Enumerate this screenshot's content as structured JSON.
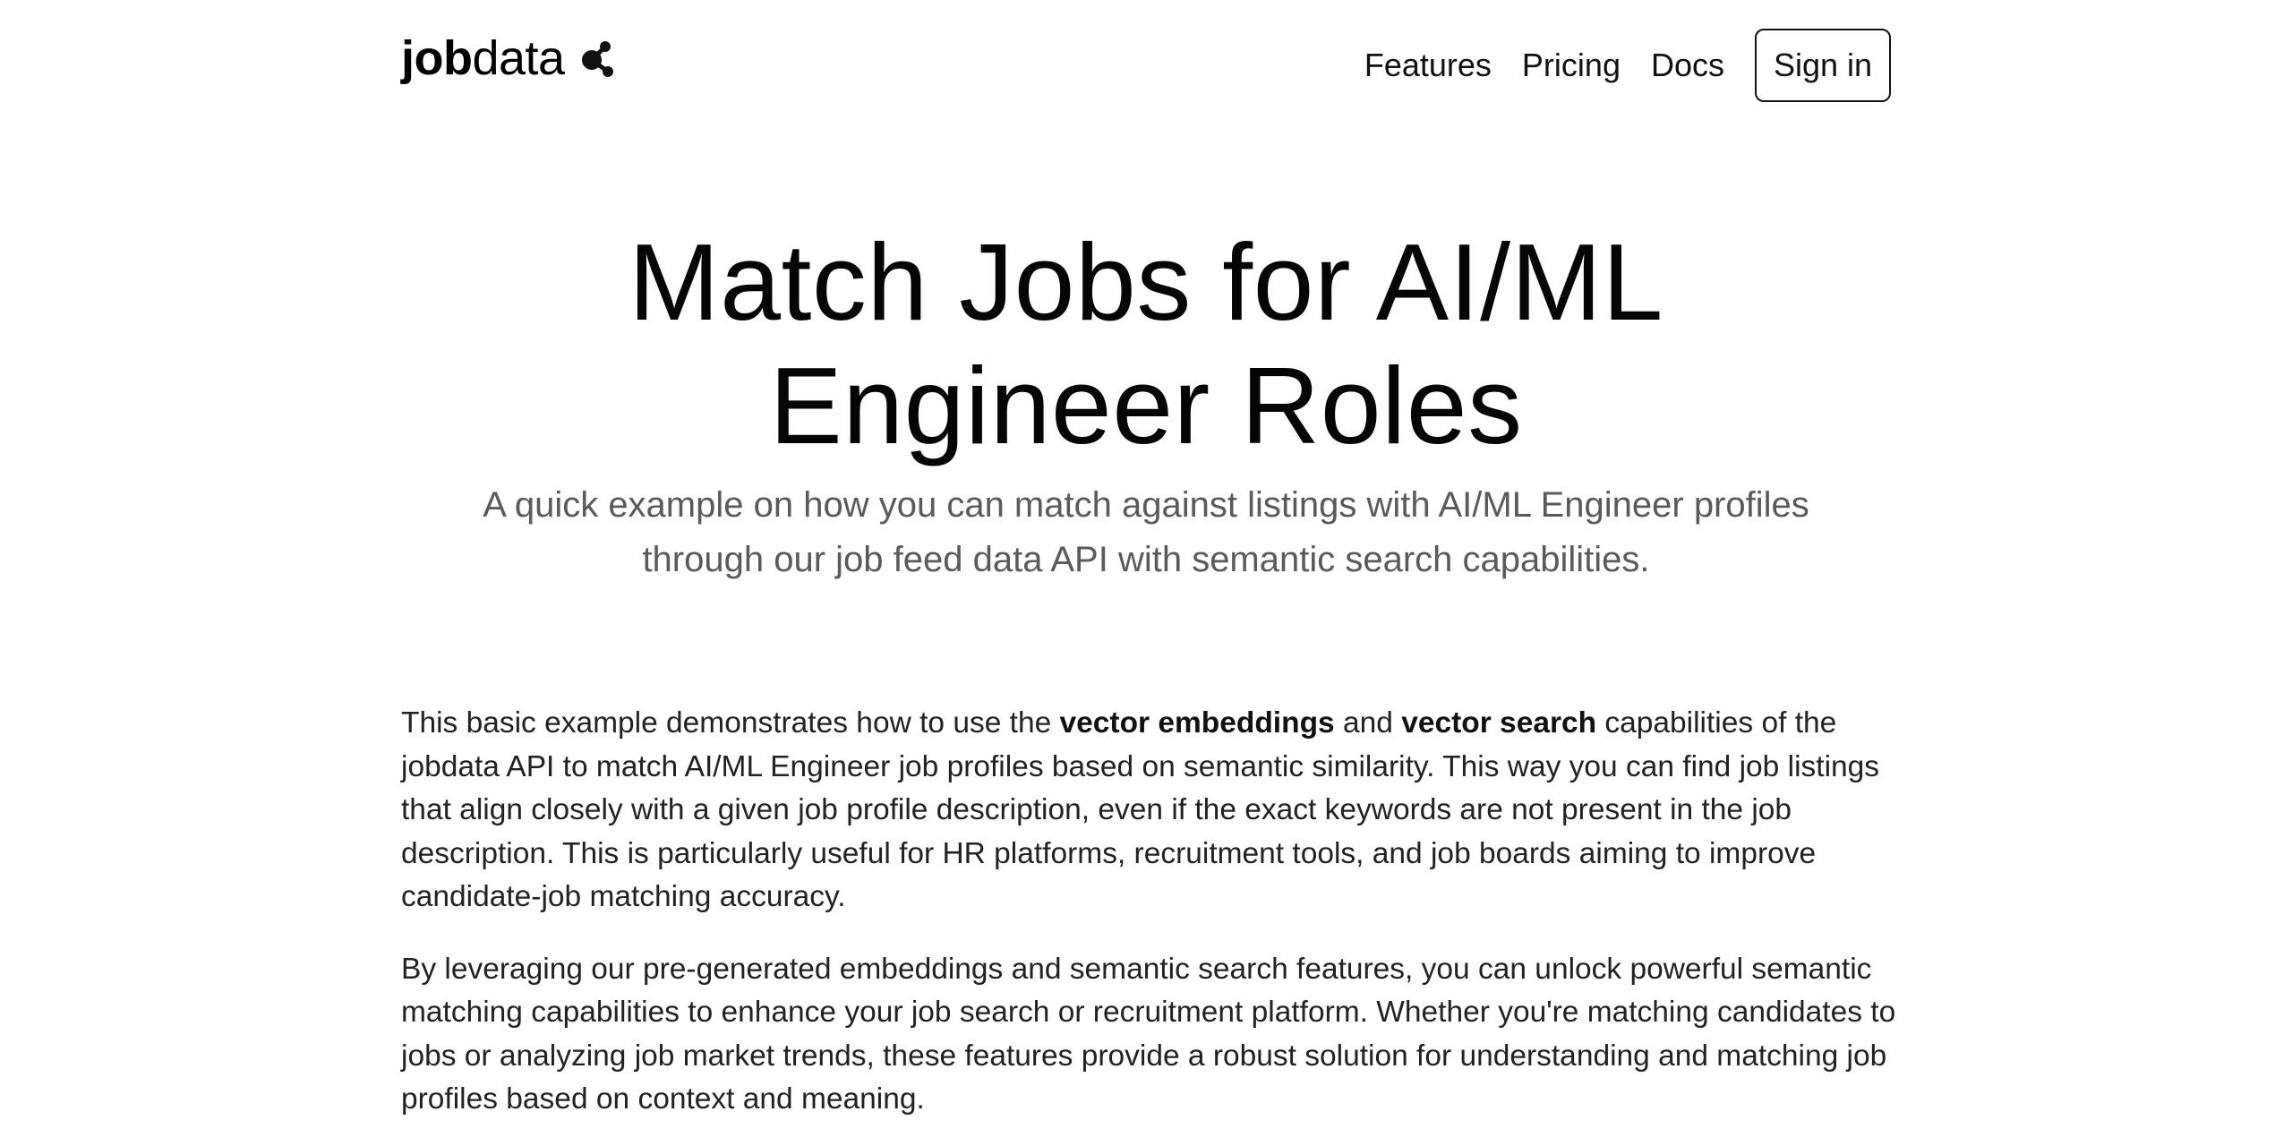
{
  "header": {
    "logo_bold": "job",
    "logo_light": "data",
    "nav": [
      "Features",
      "Pricing",
      "Docs"
    ],
    "signin_label": "Sign in"
  },
  "hero": {
    "title_line1": "Match Jobs for AI/ML",
    "title_line2": "Engineer Roles",
    "subtitle_line1": "A quick example on how you can match against listings with AI/ML Engineer profiles",
    "subtitle_line2": "through our job feed data API with semantic search capabilities."
  },
  "body": {
    "p1_a": "This basic example demonstrates how to use the ",
    "p1_b": "vector embeddings",
    "p1_c": " and ",
    "p1_d": "vector search",
    "p1_e": " capabilities of the jobdata API to match AI/ML Engineer job profiles based on semantic similarity. This way you can find job listings that align closely with a given job profile description, even if the exact keywords are not present in the job description. This is particularly useful for HR platforms, recruitment tools, and job boards aiming to improve candidate-job matching accuracy.",
    "p2": "By leveraging our pre-generated embeddings and semantic search features, you can unlock powerful semantic matching capabilities to enhance your job search or recruitment platform. Whether you're matching candidates to jobs or analyzing job market trends, these features provide a robust solution for understanding and matching job profiles based on context and meaning."
  },
  "icons": {
    "logo_mark": "molecule-icon"
  }
}
